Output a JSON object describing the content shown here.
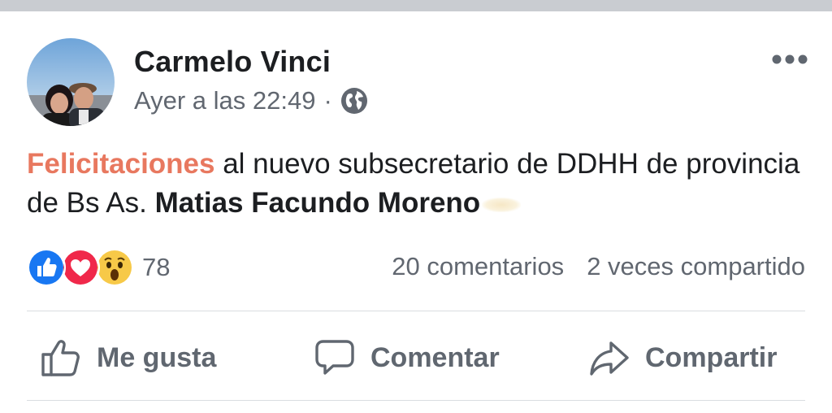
{
  "post": {
    "author": "Carmelo Vinci",
    "timestamp": "Ayer a las 22:49",
    "separator": "·",
    "privacy_icon": "globe-icon",
    "more_icon": "more-options-icon",
    "text": {
      "highlight": "Felicitaciones",
      "part1": " al nuevo subsecretario de DDHH de provincia de Bs As. ",
      "mention": "Matias Facundo Moreno"
    }
  },
  "stats": {
    "reactions": [
      "like-icon",
      "love-icon",
      "wow-icon"
    ],
    "reaction_count": "78",
    "comments": "20 comentarios",
    "shares": "2 veces compartido"
  },
  "actions": {
    "like_label": "Me gusta",
    "comment_label": "Comentar",
    "share_label": "Compartir"
  },
  "colors": {
    "highlight": "#e8785f",
    "like_blue": "#1877f2",
    "love_red": "#f0284a",
    "wow_yellow": "#f7c948",
    "text_secondary": "#616770"
  }
}
